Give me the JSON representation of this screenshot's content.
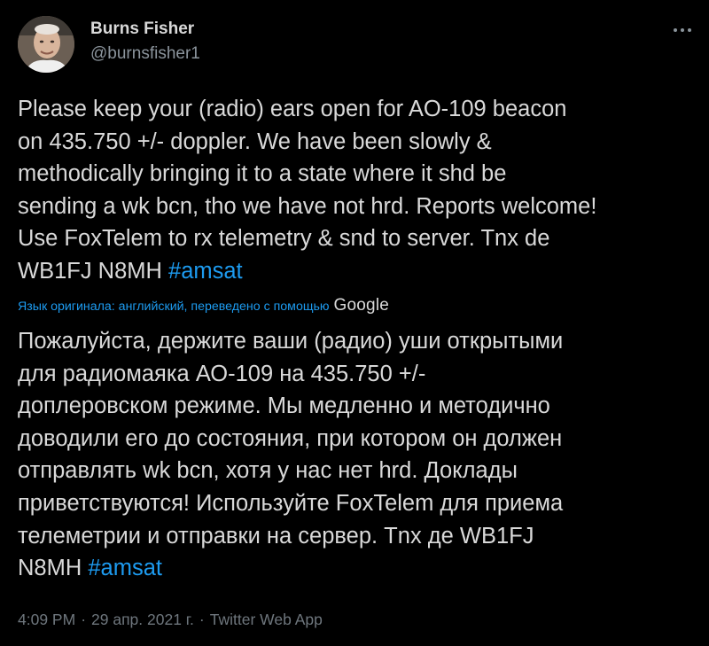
{
  "author": {
    "name": "Burns Fisher",
    "handle": "@burnsfisher1"
  },
  "tweet": {
    "lines": [
      "Please keep your (radio) ears open for AO-109 beacon",
      "on 435.750 +/- doppler.  We have been slowly &",
      "methodically bringing it to a state where it shd be",
      "sending a wk bcn, tho we have not hrd. Reports welcome!",
      "Use FoxTelem to rx telemetry & snd to server.  Tnx de",
      "WB1FJ N8MH "
    ],
    "hashtag": "#amsat"
  },
  "translation": {
    "note": "Язык оригинала: английский, переведено с помощью",
    "provider": "Google",
    "lines": [
      "Пожалуйста, держите ваши (радио) уши открытыми",
      "для радиомаяка АО-109 на 435.750 +/-",
      "доплеровском режиме. Мы медленно и методично",
      "доводили его до состояния, при котором он должен",
      "отправлять wk bcn, хотя у нас нет hrd. Доклады",
      "приветствуются! Используйте FoxTelem для приема",
      "телеметрии и отправки на сервер. Tnx де WB1FJ",
      "N8MH "
    ],
    "hashtag": "#amsat"
  },
  "meta": {
    "time": "4:09 PM",
    "date": "29 апр. 2021 г.",
    "source": "Twitter Web App",
    "separator": "·"
  },
  "icons": {
    "more": "more-horizontal-icon",
    "avatar": "avatar-photo"
  },
  "colors": {
    "background": "#000000",
    "text": "#d9d9d9",
    "secondary": "#8b949c",
    "accent": "#1d9bf0"
  }
}
